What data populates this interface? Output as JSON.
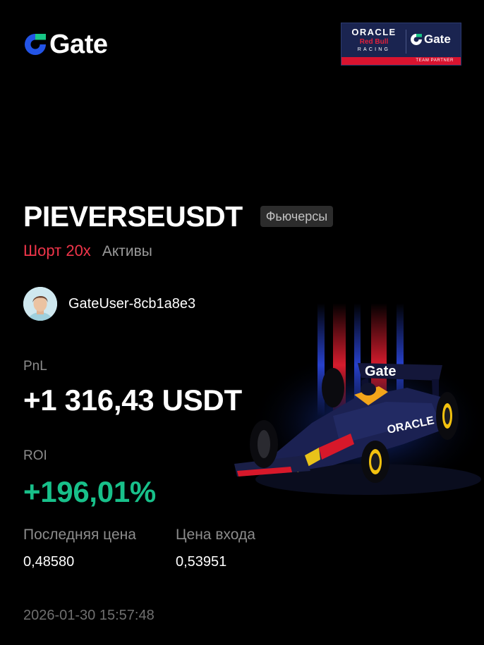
{
  "brand": {
    "name": "Gate",
    "accent": "#2354e6",
    "accent_secondary": "#17c786"
  },
  "partner_badge": {
    "oracle": "ORACLE",
    "red_bull": "Red Bull",
    "racing": "RACING",
    "gate": "Gate",
    "team_partner": "TEAM PARTNER"
  },
  "position": {
    "pair": "PIEVERSEUSDT",
    "type_badge": "Фьючерсы",
    "direction": "Шорт 20x",
    "mode": "Активы",
    "direction_color": "#f0354a"
  },
  "user": {
    "name": "GateUser-8cb1a8e3",
    "avatar_icon": "avatar"
  },
  "stats": {
    "pnl_label": "PnL",
    "pnl_value": "+1 316,43 USDT",
    "roi_label": "ROI",
    "roi_value": "+196,01%",
    "roi_color": "#18c08a"
  },
  "prices": {
    "last_label": "Последняя цена",
    "last_value": "0,48580",
    "entry_label": "Цена входа",
    "entry_value": "0,53951"
  },
  "timestamp": "2026-01-30 15:57:48"
}
